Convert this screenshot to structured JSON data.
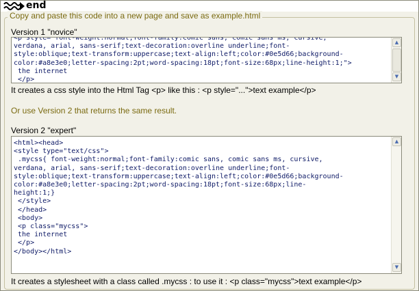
{
  "header": {
    "title": "end",
    "icon": "wave-arrow-icon"
  },
  "panel": {
    "legend": "Copy and paste this code into a new page and save as example.html",
    "version1": {
      "label": "Version 1 \"novice\"",
      "code_lines": [
        "<p style=\"font-weight:normal;font-family:comic sans, comic sans ms, cursive,",
        "verdana, arial, sans-serif;text-decoration:overline underline;font-",
        "style:oblique;text-transform:uppercase;text-align:left;color:#0e5d66;background-",
        "color:#a8e3e0;letter-spacing:2pt;word-spacing:18pt;font-size:68px;line-height:1;\">",
        " the internet",
        " </p>"
      ],
      "description": "It creates a css style into the Html Tag <p> like this : <p style=\"...\">text example</p>"
    },
    "or_text": "Or use Version 2 that returns the same result.",
    "version2": {
      "label": "Version 2 \"expert\"",
      "code_lines": [
        "<html><head>",
        "<style type=\"text/css\">",
        " .mycss{ font-weight:normal;font-family:comic sans, comic sans ms, cursive,",
        "verdana, arial, sans-serif;text-decoration:overline underline;font-",
        "style:oblique;text-transform:uppercase;text-align:left;color:#0e5d66;background-",
        "color:#a8e3e0;letter-spacing:2pt;word-spacing:18pt;font-size:68px;line-",
        "height:1;}",
        " </style>",
        " </head>",
        " <body>",
        " <p class=\"mycss\">",
        " the internet",
        " </p>",
        "</body></html>"
      ],
      "description": "It creates a stylesheet with a class called .mycss : to use it : <p class=\"mycss\">text example</p>"
    }
  },
  "colors": {
    "legend_text": "#7a6a10",
    "code_text": "#0e1a66",
    "panel_bg": "#f2f1e8"
  }
}
